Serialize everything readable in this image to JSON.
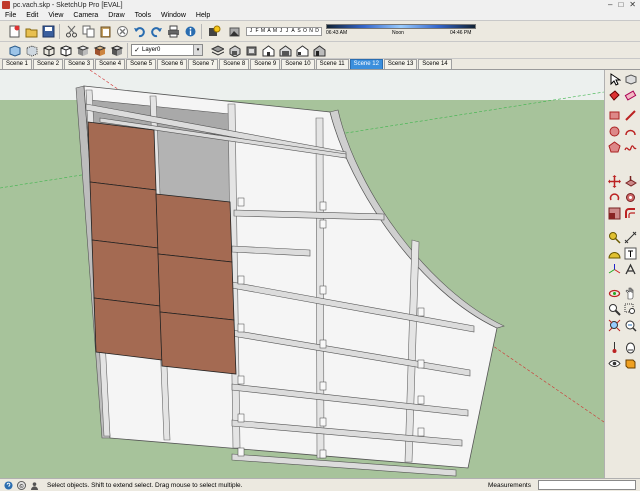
{
  "window": {
    "title": "pc.vach.skp - SketchUp Pro [EVAL]",
    "minimize": "–",
    "maximize": "□",
    "close": "✕"
  },
  "menu": [
    "File",
    "Edit",
    "View",
    "Camera",
    "Draw",
    "Tools",
    "Window",
    "Help"
  ],
  "toolbar1": {
    "icons": [
      "new-icon",
      "open-icon",
      "save-icon",
      "cut-icon",
      "copy-icon",
      "paste-icon",
      "erase-icon",
      "undo-icon",
      "redo-icon",
      "print-icon",
      "model-info-icon"
    ],
    "shadows": {
      "months": [
        "J",
        "F",
        "M",
        "A",
        "M",
        "J",
        "J",
        "A",
        "S",
        "O",
        "N",
        "D"
      ],
      "time_start": "06:43 AM",
      "time_noon": "Noon",
      "time_end": "04:46 PM"
    }
  },
  "toolbar2": {
    "icons": [
      "xray-icon",
      "back-edges-icon",
      "wireframe-icon",
      "hidden-line-icon",
      "shaded-icon",
      "shaded-textures-icon",
      "monochrome-icon"
    ],
    "layer": {
      "name": "Layer0",
      "check": "✓",
      "arrow": "▾"
    },
    "view_icons": [
      "layers-manager-icon",
      "iso-view-icon",
      "top-view-icon",
      "front-view-icon",
      "right-view-icon",
      "back-view-icon",
      "left-view-icon"
    ]
  },
  "scenes": {
    "tabs": [
      "Scene 1",
      "Scene 2",
      "Scene 3",
      "Scene 4",
      "Scene 5",
      "Scene 6",
      "Scene 7",
      "Scene 8",
      "Scene 9",
      "Scene 10",
      "Scene 11",
      "Scene 12",
      "Scene 13",
      "Scene 14"
    ],
    "active": "Scene 12"
  },
  "palette": {
    "tools": [
      "select-icon",
      "component-icon",
      "paint-bucket-icon",
      "eraser-icon",
      "rectangle-icon",
      "line-icon",
      "circle-icon",
      "arc-icon",
      "polygon-icon",
      "freehand-icon",
      "move-icon",
      "push-pull-icon",
      "rotate-icon",
      "follow-me-icon",
      "scale-icon",
      "offset-icon",
      "tape-measure-icon",
      "dimension-icon",
      "protractor-icon",
      "text-icon",
      "axes-icon",
      "3d-text-icon",
      "orbit-icon",
      "pan-icon",
      "zoom-icon",
      "zoom-window-icon",
      "zoom-extents-icon",
      "previous-view-icon",
      "position-camera-icon",
      "walk-icon",
      "look-around-icon",
      "section-plane-icon"
    ]
  },
  "status": {
    "text": "Select objects. Shift to extend select. Drag mouse to select multiple.",
    "measurements_label": "Measurements",
    "measurements_value": "",
    "icons": [
      "help-icon",
      "credits-icon",
      "user-icon"
    ]
  }
}
